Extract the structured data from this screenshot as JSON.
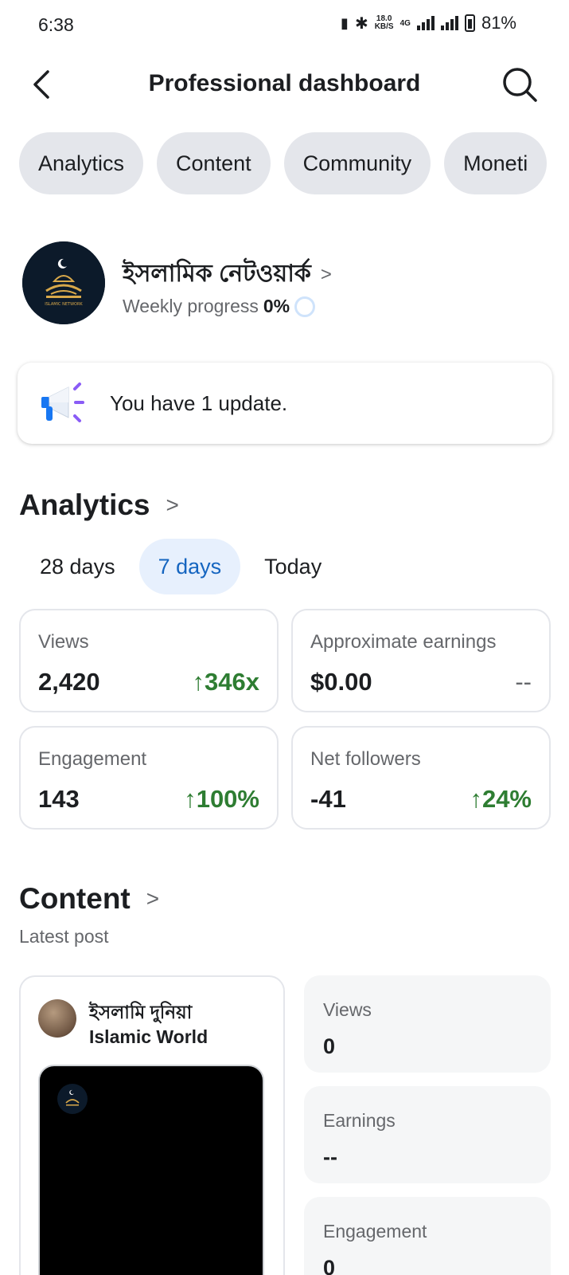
{
  "status_bar": {
    "time": "6:38",
    "speed_value": "18.0",
    "speed_unit": "KB/S",
    "network": "4G",
    "battery": "81%"
  },
  "header": {
    "title": "Professional dashboard",
    "back_icon": "back-arrow-icon",
    "search_icon": "search-icon"
  },
  "tabs": [
    "Analytics",
    "Content",
    "Community",
    "Moneti"
  ],
  "profile": {
    "name": "ইসলামিক নেটওয়ার্ক",
    "progress_label": "Weekly progress",
    "progress_value": "0%",
    "avatar_text": "ISLAMIC NETWORK"
  },
  "update": {
    "text": "You have 1 update.",
    "icon": "megaphone-icon"
  },
  "analytics": {
    "title": "Analytics",
    "ranges": [
      "28 days",
      "7 days",
      "Today"
    ],
    "selected_range": "7 days",
    "metrics": [
      {
        "label": "Views",
        "value": "2,420",
        "delta": "↑346x"
      },
      {
        "label": "Approximate earnings",
        "value": "$0.00",
        "delta": "--"
      },
      {
        "label": "Engagement",
        "value": "143",
        "delta": "↑100%"
      },
      {
        "label": "Net followers",
        "value": "-41",
        "delta": "↑24%"
      }
    ]
  },
  "content": {
    "title": "Content",
    "subtitle": "Latest post",
    "post": {
      "page_name_bn": "ইসলামি দুনিয়া",
      "page_name_en": "Islamic World"
    },
    "stats": [
      {
        "label": "Views",
        "value": "0"
      },
      {
        "label": "Earnings",
        "value": "--"
      },
      {
        "label": "Engagement",
        "value": "0"
      }
    ]
  },
  "colors": {
    "positive": "#2e7d32",
    "accent": "#1565c0",
    "pill_bg": "#e4e6eb",
    "active_range_bg": "#e7f0fd"
  }
}
